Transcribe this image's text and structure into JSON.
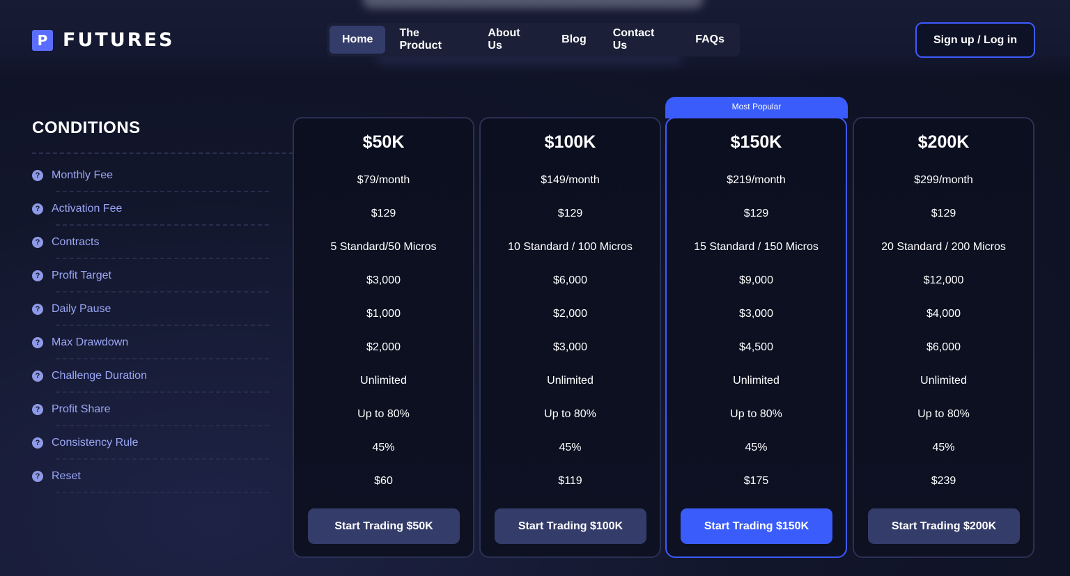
{
  "brand": {
    "mark": "P",
    "name": "FUTURES"
  },
  "nav": {
    "items": [
      {
        "label": "Home",
        "active": true
      },
      {
        "label": "The Product",
        "active": false
      },
      {
        "label": "About Us",
        "active": false
      },
      {
        "label": "Blog",
        "active": false
      },
      {
        "label": "Contact Us",
        "active": false
      },
      {
        "label": "FAQs",
        "active": false
      }
    ]
  },
  "auth": {
    "label": "Sign up / Log in"
  },
  "conditions": {
    "title": "CONDITIONS",
    "items": [
      {
        "icon": "question-circle-icon",
        "label": "Monthly Fee"
      },
      {
        "icon": "question-circle-icon",
        "label": "Activation Fee"
      },
      {
        "icon": "question-circle-icon",
        "label": "Contracts"
      },
      {
        "icon": "question-circle-icon",
        "label": "Profit Target"
      },
      {
        "icon": "question-circle-icon",
        "label": "Daily Pause"
      },
      {
        "icon": "question-circle-icon",
        "label": "Max Drawdown"
      },
      {
        "icon": "question-circle-icon",
        "label": "Challenge Duration"
      },
      {
        "icon": "question-circle-icon",
        "label": "Profit Share"
      },
      {
        "icon": "question-circle-icon",
        "label": "Consistency Rule"
      },
      {
        "icon": "question-circle-icon",
        "label": "Reset"
      }
    ]
  },
  "popular_badge": "Most Popular",
  "plans": [
    {
      "title": "$50K",
      "values": [
        "$79/month",
        "$129",
        "5 Standard/50 Micros",
        "$3,000",
        "$1,000",
        "$2,000",
        "Unlimited",
        "Up to 80%",
        "45%",
        "$60"
      ],
      "cta": "Start Trading $50K"
    },
    {
      "title": "$100K",
      "values": [
        "$149/month",
        "$129",
        "10 Standard / 100 Micros",
        "$6,000",
        "$2,000",
        "$3,000",
        "Unlimited",
        "Up to 80%",
        "45%",
        "$119"
      ],
      "cta": "Start Trading $100K"
    },
    {
      "title": "$150K",
      "values": [
        "$219/month",
        "$129",
        "15 Standard / 150 Micros",
        "$9,000",
        "$3,000",
        "$4,500",
        "Unlimited",
        "Up to 80%",
        "45%",
        "$175"
      ],
      "cta": "Start Trading $150K"
    },
    {
      "title": "$200K",
      "values": [
        "$299/month",
        "$129",
        "20 Standard / 200 Micros",
        "$12,000",
        "$4,000",
        "$6,000",
        "Unlimited",
        "Up to 80%",
        "45%",
        "$239"
      ],
      "cta": "Start Trading $200K"
    }
  ],
  "colors": {
    "accent": "#3a5cfb",
    "button": "#343c6a",
    "condition_label": "#9aa6f4",
    "background": "#12162b"
  }
}
